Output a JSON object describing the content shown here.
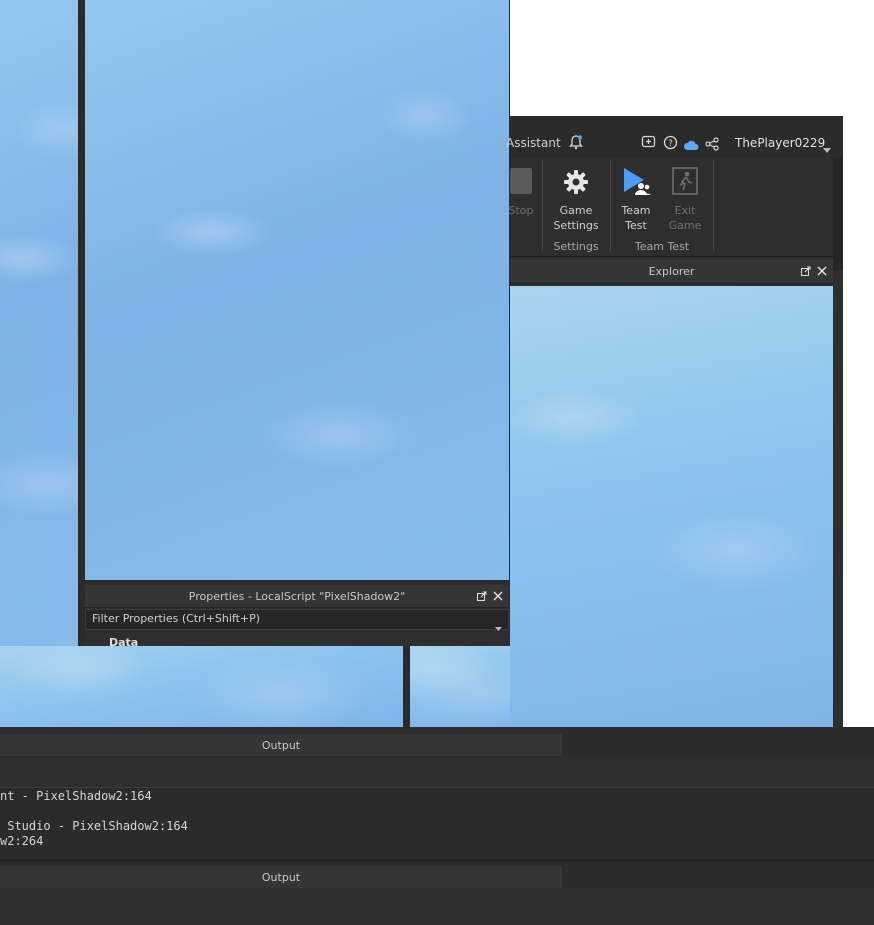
{
  "topbar": {
    "assistant_label": "Assistant",
    "username": "ThePlayer0229"
  },
  "ribbon": {
    "stop_label": "Stop",
    "game_settings_label": "Game\nSettings",
    "team_test_label": "Team\nTest",
    "exit_game_label": "Exit\nGame",
    "settings_group": "Settings",
    "team_test_group": "Team Test"
  },
  "explorer": {
    "title": "Explorer"
  },
  "properties": {
    "title": "Properties - LocalScript \"PixelShadow2\"",
    "filter_placeholder": "Filter Properties (Ctrl+Shift+P)",
    "section": "Data"
  },
  "output1": {
    "title": "Output",
    "lines": [
      "nt - PixelShadow2:164",
      "",
      " Studio - PixelShadow2:164",
      "w2:264"
    ]
  },
  "output2": {
    "title": "Output"
  }
}
